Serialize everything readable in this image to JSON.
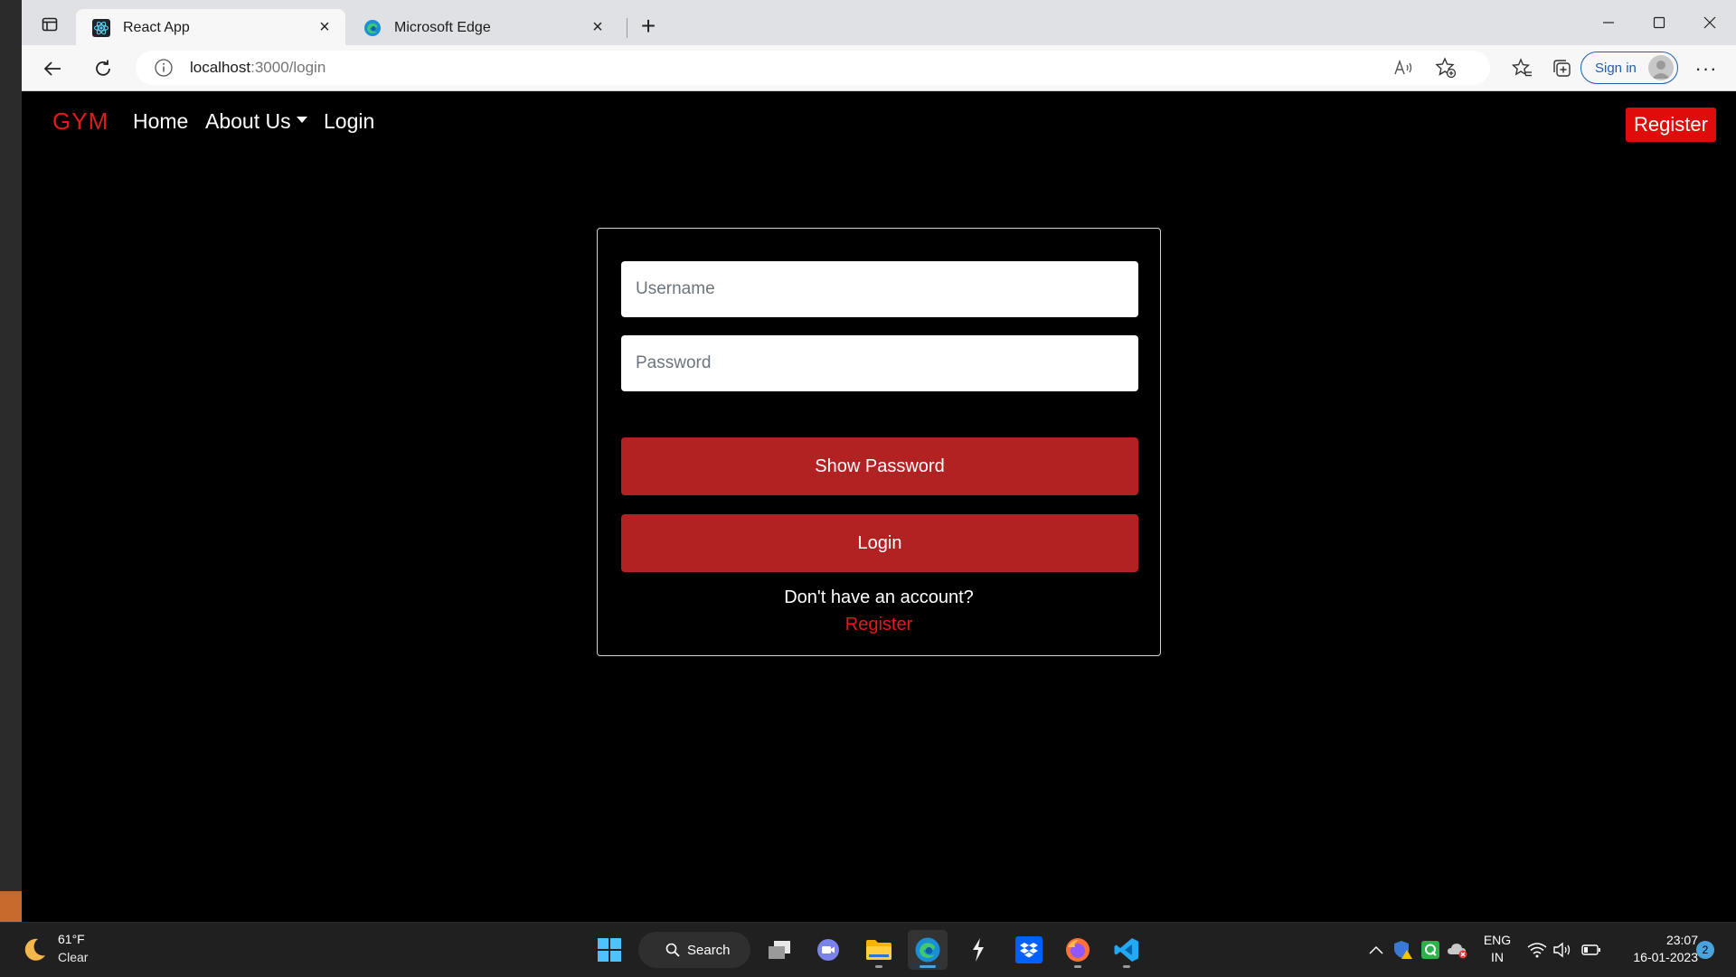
{
  "browser": {
    "tabs": [
      {
        "title": "React App",
        "favicon": "react-icon"
      },
      {
        "title": "Microsoft Edge",
        "favicon": "edge-icon"
      }
    ],
    "url_host": "localhost",
    "url_path": ":3000/login",
    "signin_label": "Sign in"
  },
  "navbar": {
    "brand": "GYM",
    "links": [
      "Home",
      "About Us",
      "Login"
    ],
    "register_label": "Register",
    "accent": "#e00c0c"
  },
  "login_form": {
    "username_placeholder": "Username",
    "password_placeholder": "Password",
    "show_password_label": "Show Password",
    "login_label": "Login",
    "no_account_text": "Don't have an account?",
    "register_link": "Register",
    "button_color": "#b22222"
  },
  "taskbar": {
    "weather_temp": "61°F",
    "weather_condition": "Clear",
    "search_label": "Search",
    "language_line1": "ENG",
    "language_line2": "IN",
    "time": "23:07",
    "date": "16-01-2023",
    "notification_count": "2"
  }
}
